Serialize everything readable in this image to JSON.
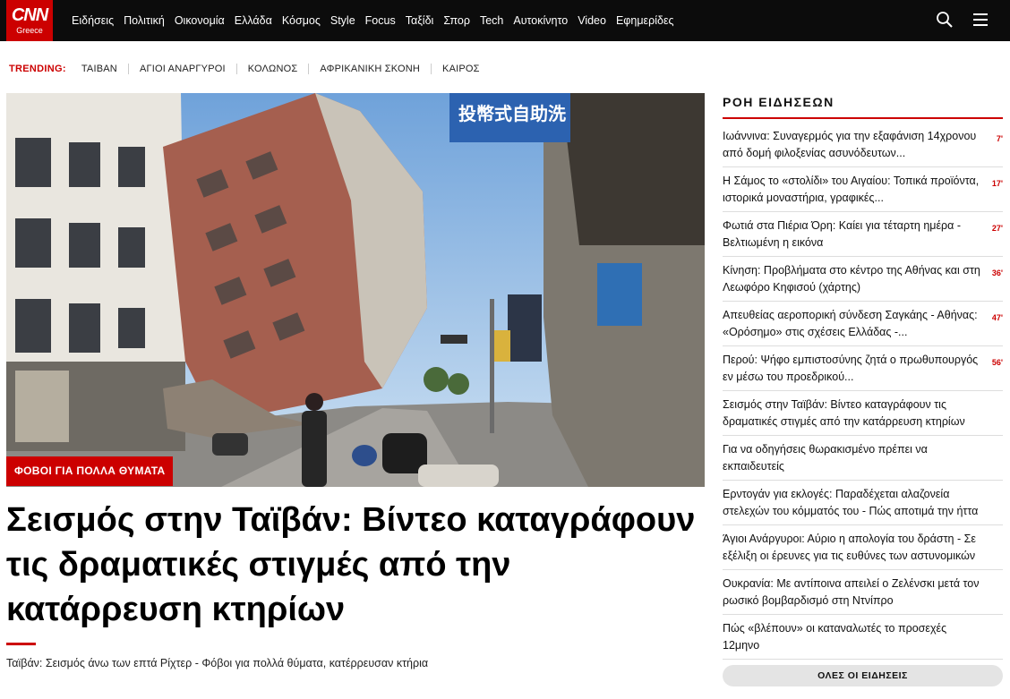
{
  "logo": {
    "brand": "CNN",
    "region": "Greece"
  },
  "nav": {
    "items": [
      "Ειδήσεις",
      "Πολιτική",
      "Οικονομία",
      "Ελλάδα",
      "Κόσμος",
      "Style",
      "Focus",
      "Ταξίδι",
      "Σπορ",
      "Tech",
      "Αυτοκίνητο",
      "Video",
      "Εφημερίδες"
    ],
    "icons": [
      "search-icon",
      "menu-icon"
    ]
  },
  "trending": {
    "label": "TRENDING:",
    "items": [
      "ΤΑΙΒΑΝ",
      "ΑΓΙΟΙ ΑΝΑΡΓΥΡΟΙ",
      "ΚΟΛΩΝΟΣ",
      "ΑΦΡΙΚΑΝΙΚΗ ΣΚΟΝΗ",
      "ΚΑΙΡΟΣ"
    ]
  },
  "hero": {
    "tag": "ΦΟΒΟΙ ΓΙΑ ΠΟΛΛΑ ΘΥΜΑΤΑ",
    "headline": "Σεισμός στην Ταϊβάν: Βίντεο καταγράφουν τις δραματικές στιγμές από την κατάρρευση κτηρίων",
    "subline": "Ταϊβάν: Σεισμός άνω των επτά Ρίχτερ - Φόβοι για πολλά θύματα, κατέρρευσαν κτήρια",
    "sign_text": "投幣式自助洗"
  },
  "feed": {
    "title": "ΡΟΗ ΕΙΔΗΣΕΩΝ",
    "items": [
      {
        "text": "Ιωάννινα: Συναγερμός για την εξαφάνιση 14χρονου από δομή φιλοξενίας ασυνόδευτων...",
        "ago": "7'"
      },
      {
        "text": "Η Σάμος το «στολίδι» του Αιγαίου: Τοπικά προϊόντα, ιστορικά μοναστήρια, γραφικές...",
        "ago": "17'"
      },
      {
        "text": "Φωτιά στα Πιέρια Όρη: Καίει για τέταρτη ημέρα - Βελτιωμένη η εικόνα",
        "ago": "27'"
      },
      {
        "text": "Κίνηση: Προβλήματα στο κέντρο της Αθήνας και στη Λεωφόρο Κηφισού (χάρτης)",
        "ago": "36'"
      },
      {
        "text": "Απευθείας αεροπορική σύνδεση Σαγκάης - Αθήνας: «Ορόσημο» στις σχέσεις Ελλάδας -...",
        "ago": "47'"
      },
      {
        "text": "Περού: Ψήφο εμπιστοσύνης ζητά ο πρωθυπουργός εν μέσω του προεδρικού...",
        "ago": "56'"
      },
      {
        "text": "Σεισμός στην Ταϊβάν: Βίντεο καταγράφουν τις δραματικές στιγμές από την κατάρρευση κτηρίων",
        "ago": ""
      },
      {
        "text": "Για να οδηγήσεις θωρακισμένο πρέπει να εκπαιδευτείς",
        "ago": ""
      },
      {
        "text": "Ερντογάν για εκλογές: Παραδέχεται αλαζονεία στελεχών του κόμματός του - Πώς αποτιμά την ήττα",
        "ago": ""
      },
      {
        "text": "Άγιοι Ανάργυροι: Αύριο η απολογία του δράστη - Σε εξέλιξη οι έρευνες για τις ευθύνες των αστυνομικών",
        "ago": ""
      },
      {
        "text": "Ουκρανία: Με αντίποινα απειλεί ο Ζελένσκι μετά τον ρωσικό βομβαρδισμό στη Ντνίπρο",
        "ago": ""
      },
      {
        "text": "Πώς «βλέπουν» οι καταναλωτές το προσεχές 12μηνο",
        "ago": ""
      }
    ],
    "all_label": "ΟΛΕΣ ΟΙ ΕΙΔΗΣΕΙΣ"
  }
}
